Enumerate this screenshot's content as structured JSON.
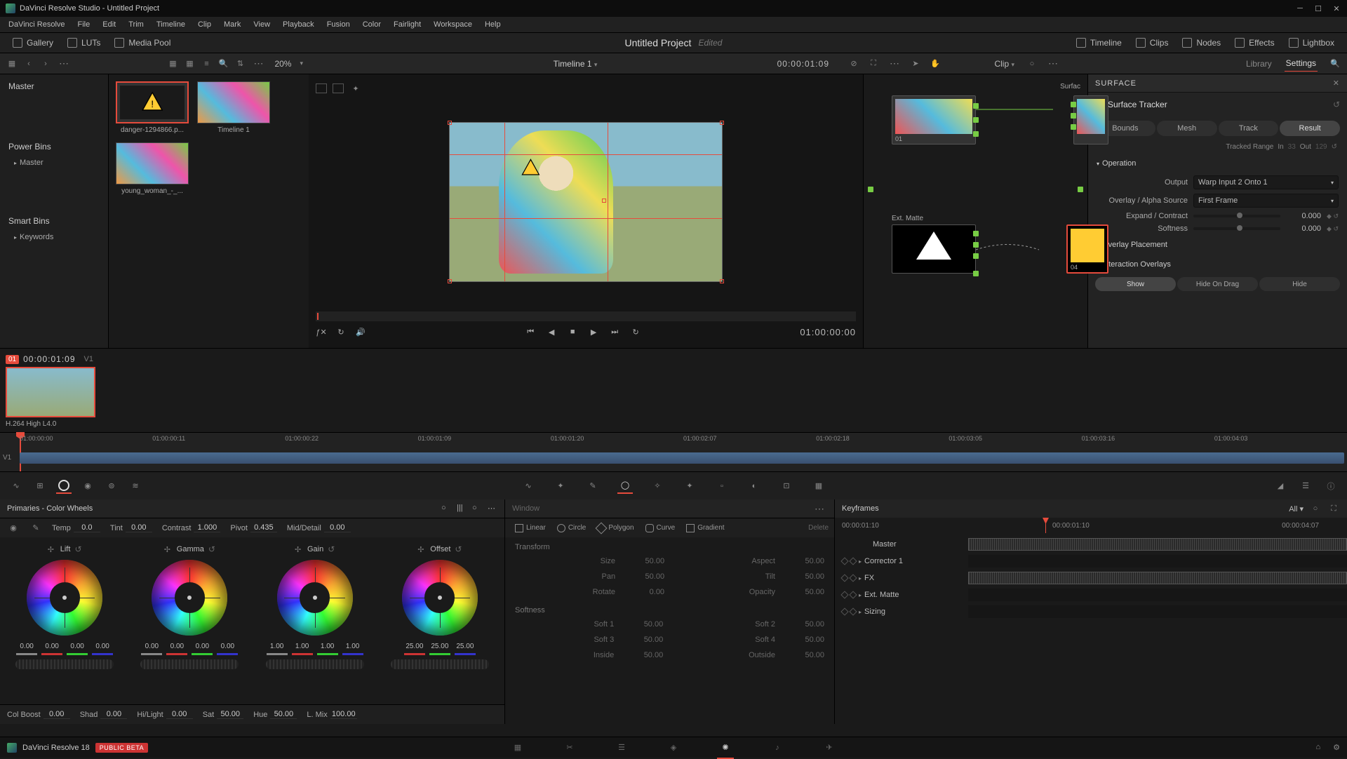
{
  "titlebar": {
    "title": "DaVinci Resolve Studio - Untitled Project"
  },
  "menu": [
    "DaVinci Resolve",
    "File",
    "Edit",
    "Trim",
    "Timeline",
    "Clip",
    "Mark",
    "View",
    "Playback",
    "Fusion",
    "Color",
    "Fairlight",
    "Workspace",
    "Help"
  ],
  "toptool": {
    "gallery": "Gallery",
    "luts": "LUTs",
    "mediapool": "Media Pool",
    "timeline": "Timeline",
    "clips": "Clips",
    "nodes": "Nodes",
    "effects": "Effects",
    "lightbox": "Lightbox"
  },
  "project": {
    "name": "Untitled Project",
    "status": "Edited"
  },
  "secbar": {
    "zoom": "20%",
    "timeline_name": "Timeline 1",
    "timecode": "00:00:01:09",
    "clip": "Clip",
    "library": "Library",
    "settings": "Settings"
  },
  "mediatree": {
    "master": "Master",
    "powerbins": "Power Bins",
    "pb_master": "Master",
    "smartbins": "Smart Bins",
    "keywords": "Keywords"
  },
  "thumbs": [
    {
      "label": "danger-1294866.p..."
    },
    {
      "label": "Timeline 1"
    },
    {
      "label": "young_woman_-_..."
    }
  ],
  "viewer": {
    "timecode": "01:00:00:00"
  },
  "nodes": {
    "ext_matte": "Ext. Matte",
    "surface_label": "Surfac",
    "n01": "01",
    "n04": "04"
  },
  "surface": {
    "header": "SURFACE",
    "tracker": "Surface Tracker",
    "tabs": [
      "Bounds",
      "Mesh",
      "Track",
      "Result"
    ],
    "tracked": "Tracked Range",
    "in": "In",
    "in_v": "33",
    "out": "Out",
    "out_v": "129",
    "operation": "Operation",
    "output_lbl": "Output",
    "output_v": "Warp Input 2 Onto 1",
    "overlay_lbl": "Overlay / Alpha Source",
    "overlay_v": "First Frame",
    "expand_lbl": "Expand / Contract",
    "expand_v": "0.000",
    "soft_lbl": "Softness",
    "soft_v": "0.000",
    "placement": "Overlay Placement",
    "inter": "Interaction Overlays",
    "show": [
      "Show",
      "Hide On Drag",
      "Hide"
    ]
  },
  "clip": {
    "idx": "01",
    "tc": "00:00:01:09",
    "track": "V1",
    "codec": "H.264 High L4.0"
  },
  "ruler": [
    "01:00:00:00",
    "01:00:00:11",
    "01:00:00:22",
    "01:00:01:09",
    "01:00:01:20",
    "01:00:02:07",
    "01:00:02:18",
    "01:00:03:05",
    "01:00:03:16",
    "01:00:04:03"
  ],
  "primaries": {
    "title": "Primaries - Color Wheels",
    "params1": [
      {
        "l": "Temp",
        "v": "0.0"
      },
      {
        "l": "Tint",
        "v": "0.00"
      },
      {
        "l": "Contrast",
        "v": "1.000"
      },
      {
        "l": "Pivot",
        "v": "0.435"
      },
      {
        "l": "Mid/Detail",
        "v": "0.00"
      }
    ],
    "wheels": [
      {
        "name": "Lift",
        "vals": [
          "0.00",
          "0.00",
          "0.00",
          "0.00"
        ]
      },
      {
        "name": "Gamma",
        "vals": [
          "0.00",
          "0.00",
          "0.00",
          "0.00"
        ]
      },
      {
        "name": "Gain",
        "vals": [
          "1.00",
          "1.00",
          "1.00",
          "1.00"
        ]
      },
      {
        "name": "Offset",
        "vals": [
          "25.00",
          "25.00",
          "25.00"
        ]
      }
    ],
    "params2": [
      {
        "l": "Col Boost",
        "v": "0.00"
      },
      {
        "l": "Shad",
        "v": "0.00"
      },
      {
        "l": "Hi/Light",
        "v": "0.00"
      },
      {
        "l": "Sat",
        "v": "50.00"
      },
      {
        "l": "Hue",
        "v": "50.00"
      },
      {
        "l": "L. Mix",
        "v": "100.00"
      }
    ]
  },
  "window": {
    "title": "Window",
    "shapes": [
      "Linear",
      "Circle",
      "Polygon",
      "Curve",
      "Gradient"
    ],
    "delete": "Delete",
    "transform": "Transform",
    "tr": [
      {
        "l": "Size",
        "v": "50.00",
        "l2": "Aspect",
        "v2": "50.00"
      },
      {
        "l": "Pan",
        "v": "50.00",
        "l2": "Tilt",
        "v2": "50.00"
      },
      {
        "l": "Rotate",
        "v": "0.00",
        "l2": "Opacity",
        "v2": "50.00"
      }
    ],
    "softness": "Softness",
    "sf": [
      {
        "l": "Soft 1",
        "v": "50.00",
        "l2": "Soft 2",
        "v2": "50.00"
      },
      {
        "l": "Soft 3",
        "v": "50.00",
        "l2": "Soft 4",
        "v2": "50.00"
      },
      {
        "l": "Inside",
        "v": "50.00",
        "l2": "Outside",
        "v2": "50.00"
      }
    ]
  },
  "keyframes": {
    "title": "Keyframes",
    "all": "All",
    "tc1": "00:00:01:10",
    "tc2": "00:00:01:10",
    "tc3": "00:00:04:07",
    "rows": [
      "Master",
      "Corrector 1",
      "FX",
      "Ext. Matte",
      "Sizing"
    ]
  },
  "bottombar": {
    "appname": "DaVinci Resolve 18",
    "beta": "PUBLIC BETA"
  }
}
